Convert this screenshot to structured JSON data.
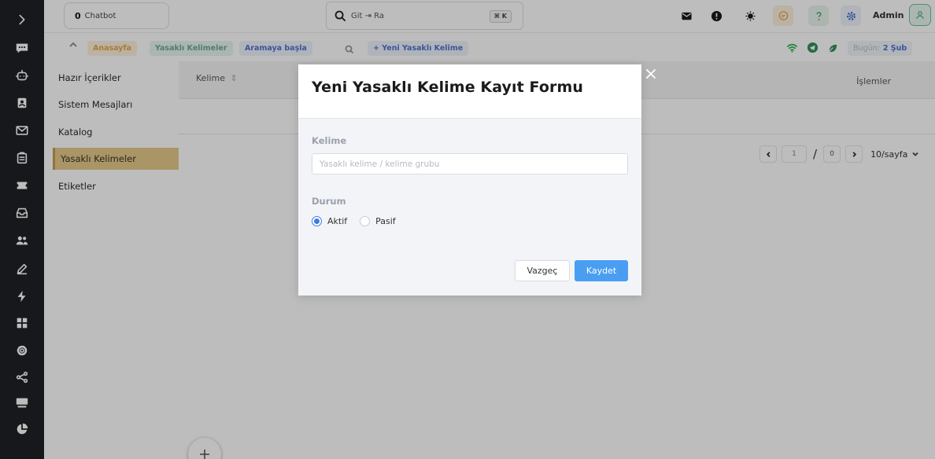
{
  "header": {
    "chatbot_count": "0",
    "chatbot_label": "Chatbot",
    "search_value": "Git ⇥ Ra",
    "search_shortcut": "⌘ K",
    "admin_label": "Admin"
  },
  "breadcrumb": {
    "home": "Anasayfa",
    "current": "Yasaklı Kelimeler",
    "search_start": "Aramaya başla",
    "new_word": "+ Yeni Yasaklı Kelime",
    "today_label": "Bugün:",
    "today_value": "2 Şub"
  },
  "subnav": {
    "items": [
      {
        "label": "Hazır İçerikler"
      },
      {
        "label": "Sistem Mesajları"
      },
      {
        "label": "Katalog"
      },
      {
        "label": "Yasaklı Kelimeler",
        "active": true
      },
      {
        "label": "Etiketler"
      }
    ]
  },
  "table": {
    "col_word": "Kelime",
    "col_sort_icon": "⇕",
    "col_actions": "İşlemler"
  },
  "pagination": {
    "current_page": "1",
    "separator": "/",
    "total_pages": "0",
    "page_size": "10/sayfa"
  },
  "modal": {
    "title": "Yeni Yasaklı Kelime Kayıt Formu",
    "word_label": "Kelime",
    "word_placeholder": "Yasaklı kelime / kelime grubu",
    "status_label": "Durum",
    "status_options": [
      "Aktif",
      "Pasif"
    ],
    "status_selected": "Aktif",
    "cancel_label": "Vazgeç",
    "save_label": "Kaydet"
  },
  "colors": {
    "rail_bg": "#1f2125",
    "accent_blue": "#4a9ef2",
    "active_item": "#e6c98b",
    "home_chip": "#e4a64a",
    "banned_chip": "#6aaa96",
    "link_blue": "#4c76cc"
  },
  "icons": {
    "rail": [
      "chevron-right-icon",
      "chat-icon",
      "bot-icon",
      "contact-icon",
      "mail-icon",
      "clipboard-icon",
      "ticket-icon",
      "inbox-icon",
      "users-icon",
      "pen-icon",
      "bolt-icon",
      "grid-icon",
      "settings-icon",
      "share-icon",
      "monitor-icon",
      "pie-chart-icon"
    ],
    "header": [
      "mail-icon",
      "alert-icon",
      "bulb-icon",
      "chat-bubble-icon",
      "help-icon",
      "gear-icon",
      "user-icon"
    ],
    "breadcrumb": [
      "chevron-up-icon",
      "search-icon",
      "wifi-icon",
      "telegram-icon",
      "leaf-icon"
    ]
  }
}
